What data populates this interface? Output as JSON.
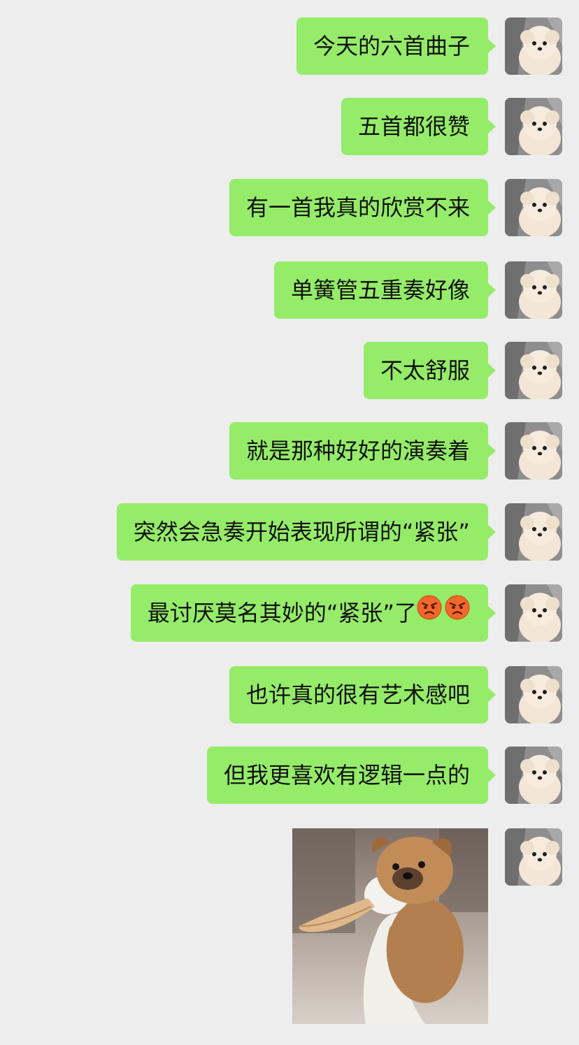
{
  "chat": {
    "messages": [
      {
        "type": "text",
        "text": "今天的六首曲子"
      },
      {
        "type": "text",
        "text": "五首都很赞"
      },
      {
        "type": "text",
        "text": "有一首我真的欣赏不来"
      },
      {
        "type": "text",
        "text": "单簧管五重奏好像"
      },
      {
        "type": "text",
        "text": "不太舒服"
      },
      {
        "type": "text",
        "text": "就是那种好好的演奏着"
      },
      {
        "type": "text",
        "text": "突然会急奏开始表现所谓的“紧张”"
      },
      {
        "type": "text",
        "text": "最讨厌莫名其妙的“紧张”了",
        "emojis": [
          "angry-face-icon",
          "angry-face-icon"
        ]
      },
      {
        "type": "text",
        "text": "也许真的很有艺术感吧"
      },
      {
        "type": "text",
        "text": "但我更喜欢有逻辑一点的"
      },
      {
        "type": "sticker",
        "sticker": "puppy-hugging-duck-sticker"
      }
    ],
    "avatar": "white-puppy-avatar",
    "colors": {
      "background": "#ededed",
      "sent_bubble": "#95ec69"
    }
  }
}
